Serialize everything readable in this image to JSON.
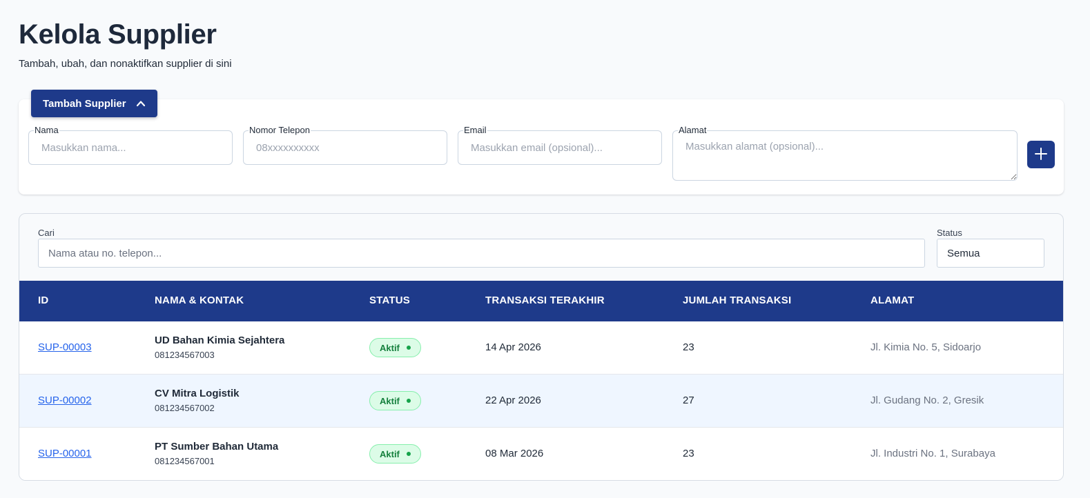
{
  "header": {
    "title": "Kelola Supplier",
    "subtitle": "Tambah, ubah, dan nonaktifkan supplier di sini"
  },
  "form": {
    "toggle_label": "Tambah Supplier",
    "toggle_icon": "chevron-up-icon",
    "fields": [
      {
        "label": "Nama",
        "placeholder": "Masukkan nama...",
        "value": ""
      },
      {
        "label": "Nomor Telepon",
        "placeholder": "08xxxxxxxxxx",
        "value": ""
      },
      {
        "label": "Email",
        "placeholder": "Masukkan email (opsional)...",
        "value": ""
      },
      {
        "label": "Alamat",
        "placeholder": "Masukkan alamat (opsional)...",
        "value": ""
      }
    ],
    "add_icon": "plus-icon",
    "accent_color": "#1e3a8a"
  },
  "filters": {
    "search_label": "Cari",
    "search_placeholder": "Nama atau no. telepon...",
    "status_label": "Status",
    "status_value": "Semua"
  },
  "table": {
    "columns": [
      "ID",
      "NAMA & KONTAK",
      "STATUS",
      "TRANSAKSI TERAKHIR",
      "JUMLAH TRANSAKSI",
      "ALAMAT"
    ],
    "rows": [
      {
        "id": "SUP-00003",
        "name": "UD Bahan Kimia Sejahtera",
        "phone": "081234567003",
        "status": "Aktif",
        "last_transaction": "14 Apr 2026",
        "transaction_count": "23",
        "address": "Jl. Kimia No. 5, Sidoarjo"
      },
      {
        "id": "SUP-00002",
        "name": "CV Mitra Logistik",
        "phone": "081234567002",
        "status": "Aktif",
        "last_transaction": "22 Apr 2026",
        "transaction_count": "27",
        "address": "Jl. Gudang No. 2, Gresik"
      },
      {
        "id": "SUP-00001",
        "name": "PT Sumber Bahan Utama",
        "phone": "081234567001",
        "status": "Aktif",
        "last_transaction": "08 Mar 2026",
        "transaction_count": "23",
        "address": "Jl. Industri No. 1, Surabaya"
      }
    ],
    "header_color": "#1e3a8a",
    "status_color": "#15803d"
  }
}
